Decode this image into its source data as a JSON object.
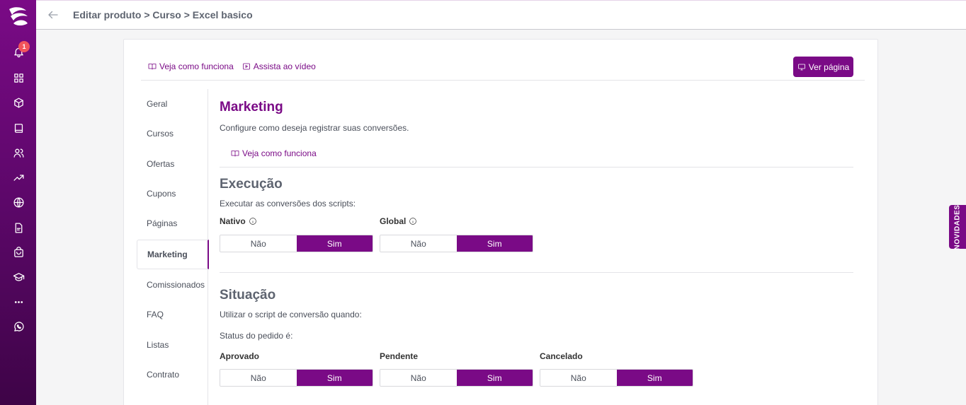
{
  "sidebar": {
    "notification_count": "1",
    "icons": [
      "bell-icon",
      "dashboard-icon",
      "product-box-icon",
      "book-icon",
      "users-icon",
      "trending-icon",
      "globe-icon",
      "document-icon",
      "store-bag-icon",
      "graduation-cap-icon",
      "more-dots-icon",
      "whatsapp-icon"
    ]
  },
  "header": {
    "breadcrumb": "Editar produto > Curso > Excel basico"
  },
  "help": {
    "how_it_works": "Veja como funciona",
    "watch_video": "Assista ao vídeo",
    "view_page": "Ver página"
  },
  "nav": {
    "items": [
      {
        "label": "Geral"
      },
      {
        "label": "Cursos"
      },
      {
        "label": "Ofertas"
      },
      {
        "label": "Cupons"
      },
      {
        "label": "Páginas"
      },
      {
        "label": "Marketing"
      },
      {
        "label": "Comissionados"
      },
      {
        "label": "FAQ"
      },
      {
        "label": "Listas"
      },
      {
        "label": "Contrato"
      }
    ],
    "active": "Marketing"
  },
  "marketing": {
    "title": "Marketing",
    "subtitle": "Configure como deseja registrar suas conversões.",
    "how_it_works": "Veja como funciona"
  },
  "execucao": {
    "title": "Execução",
    "description": "Executar as conversões dos scripts:",
    "nativo": {
      "label": "Nativo",
      "no": "Não",
      "yes": "Sim",
      "value": "Sim"
    },
    "global": {
      "label": "Global",
      "no": "Não",
      "yes": "Sim",
      "value": "Sim"
    }
  },
  "situacao": {
    "title": "Situação",
    "description": "Utilizar o script de conversão quando:",
    "status_label": "Status do pedido é:",
    "aprovado": {
      "label": "Aprovado",
      "no": "Não",
      "yes": "Sim",
      "value": "Sim"
    },
    "pendente": {
      "label": "Pendente",
      "no": "Não",
      "yes": "Sim",
      "value": "Sim"
    },
    "cancelado": {
      "label": "Cancelado",
      "no": "Não",
      "yes": "Sim",
      "value": "Sim"
    }
  },
  "novidades": "NOVIDADES",
  "colors": {
    "accent": "#7a0a86",
    "badge": "#f2545b"
  }
}
